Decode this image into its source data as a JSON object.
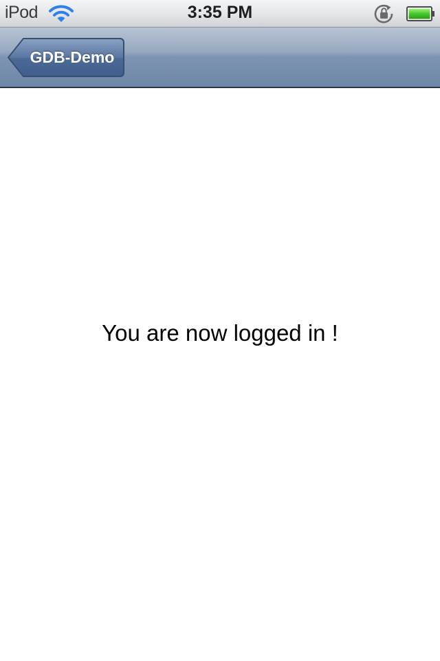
{
  "status_bar": {
    "carrier": "iPod",
    "time": "3:35 PM",
    "icons": [
      "wifi-icon",
      "rotation-lock-icon",
      "battery-icon"
    ],
    "battery_level": 1.0,
    "colors": {
      "wifi": "#2f80e8",
      "battery_fill": "#47c82b"
    }
  },
  "nav_bar": {
    "back_label": "GDB-Demo",
    "colors": {
      "tint": "#6e87a8",
      "button": "#4e6b97"
    }
  },
  "main": {
    "message": "You are now logged in !"
  }
}
